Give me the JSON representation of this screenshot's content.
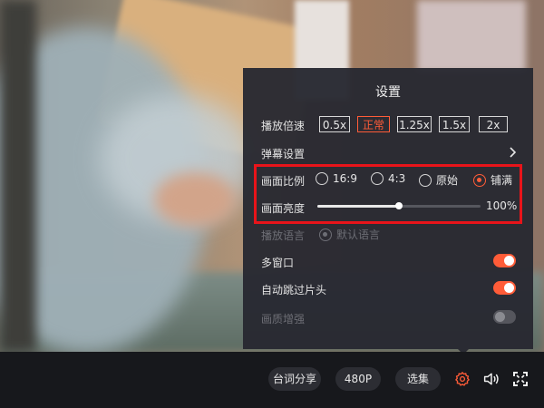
{
  "settings": {
    "title": "设置",
    "speed": {
      "label": "播放倍速",
      "options": [
        "0.5x",
        "正常",
        "1.25x",
        "1.5x",
        "2x"
      ],
      "selected": "正常"
    },
    "danmaku": {
      "label": "弹幕设置"
    },
    "aspect": {
      "label": "画面比例",
      "options": [
        "16:9",
        "4:3",
        "原始",
        "铺满"
      ],
      "selected": "铺满"
    },
    "brightness": {
      "label": "画面亮度",
      "value_text": "100%",
      "level": 0.5
    },
    "audio_lang": {
      "label": "播放语言",
      "option": "默认语言"
    },
    "multi_window": {
      "label": "多窗口",
      "on": true
    },
    "skip_intro": {
      "label": "自动跳过片头",
      "on": true
    },
    "enhance": {
      "label": "画质增强",
      "on": false
    }
  },
  "controls": {
    "lyrics_share": "台词分享",
    "quality": "480P",
    "episodes": "选集"
  },
  "colors": {
    "accent": "#ff5c38",
    "highlight_border": "#e8141a",
    "panel_bg": "#282931",
    "bar_bg": "#17181c"
  },
  "icons": [
    "chevron-right-icon",
    "gear-icon",
    "volume-icon",
    "fullscreen-icon"
  ]
}
